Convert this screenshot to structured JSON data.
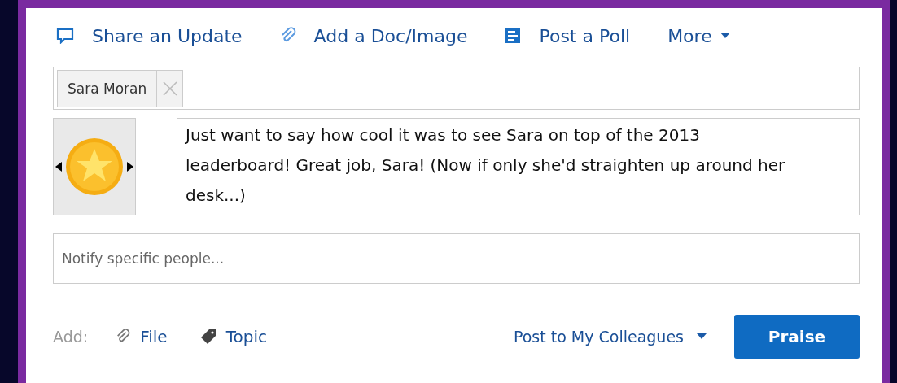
{
  "tabs": [
    {
      "label": "Share an Update",
      "kind": "update"
    },
    {
      "label": "Add a Doc/Image",
      "kind": "doc"
    },
    {
      "label": "Post a Poll",
      "kind": "poll"
    },
    {
      "label": "More",
      "kind": "more"
    }
  ],
  "recipients": [
    {
      "name": "Sara Moran"
    }
  ],
  "message": "Just want to say how cool it was to see Sara on top of the 2013 leaderboard! Great job, Sara! (Now if only she'd straighten up around her desk...)",
  "notify": {
    "placeholder": "Notify specific people..."
  },
  "footer": {
    "add_label": "Add:",
    "attachments": [
      {
        "label": "File",
        "kind": "file"
      },
      {
        "label": "Topic",
        "kind": "topic"
      }
    ],
    "audience": "Post to My Colleagues",
    "submit": "Praise"
  }
}
